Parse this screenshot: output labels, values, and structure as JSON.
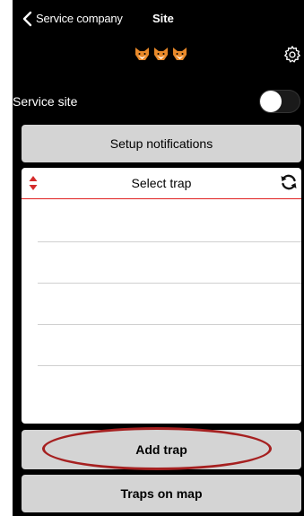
{
  "nav": {
    "back_label": "Service company",
    "title": "Site"
  },
  "header": {
    "emoji_icons": [
      "fox-icon",
      "fox-icon",
      "fox-icon"
    ],
    "settings_icon": "gear-icon"
  },
  "service_site": {
    "label": "Service site",
    "enabled": false
  },
  "buttons": {
    "setup_notifications": "Setup notifications",
    "add_trap": "Add trap",
    "traps_on_map": "Traps on map"
  },
  "trap_picker": {
    "title": "Select trap",
    "sort_icon": "sort-arrows-icon",
    "refresh_icon": "refresh-icon",
    "items": []
  },
  "colors": {
    "background": "#000000",
    "button_gray": "#d4d4d4",
    "accent_red": "#e02020",
    "annotation_red": "#a62020"
  }
}
